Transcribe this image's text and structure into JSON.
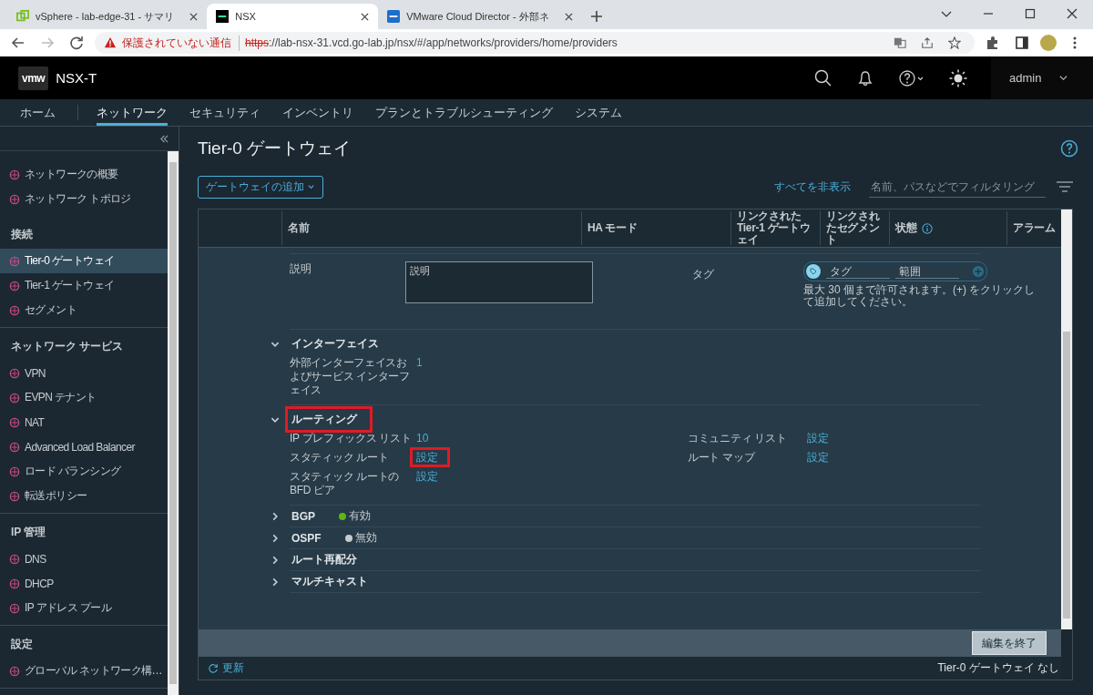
{
  "browser": {
    "tabs": [
      {
        "title": "vSphere - lab-edge-31 - サマリ",
        "selected": false
      },
      {
        "title": "NSX",
        "selected": true
      },
      {
        "title": "VMware Cloud Director - 外部ネ",
        "selected": false
      }
    ],
    "warning": "保護されていない通信",
    "scheme": "https",
    "url": "://lab-nsx-31.vcd.go-lab.jp/nsx/#/app/networks/providers/home/providers"
  },
  "app": {
    "logo": "vmw",
    "product": "NSX-T",
    "user": "admin"
  },
  "nav": [
    {
      "label": "ホーム",
      "selected": false
    },
    {
      "label": "ネットワーク",
      "selected": true
    },
    {
      "label": "セキュリティ",
      "selected": false
    },
    {
      "label": "インベントリ",
      "selected": false
    },
    {
      "label": "プランとトラブルシューティング",
      "selected": false
    },
    {
      "label": "システム",
      "selected": false
    }
  ],
  "sidebar": {
    "sections": [
      {
        "items": [
          {
            "label": "ネットワークの概要",
            "selected": false
          },
          {
            "label": "ネットワーク トポロジ",
            "selected": false
          }
        ]
      },
      {
        "heading": "接続",
        "items": [
          {
            "label": "Tier-0 ゲートウェイ",
            "selected": true
          },
          {
            "label": "Tier-1 ゲートウェイ",
            "selected": false
          },
          {
            "label": "セグメント",
            "selected": false
          }
        ]
      },
      {
        "heading": "ネットワーク サービス",
        "items": [
          {
            "label": "VPN",
            "selected": false
          },
          {
            "label": "EVPN テナント",
            "selected": false
          },
          {
            "label": "NAT",
            "selected": false
          },
          {
            "label": "Advanced Load Balancer",
            "selected": false
          },
          {
            "label": "ロード バランシング",
            "selected": false
          },
          {
            "label": "転送ポリシー",
            "selected": false
          }
        ]
      },
      {
        "heading": "IP 管理",
        "items": [
          {
            "label": "DNS",
            "selected": false
          },
          {
            "label": "DHCP",
            "selected": false
          },
          {
            "label": "IP アドレス プール",
            "selected": false
          }
        ]
      },
      {
        "heading": "設定",
        "items": [
          {
            "label": "グローバル ネットワーク構…",
            "selected": false
          }
        ]
      }
    ]
  },
  "page": {
    "title": "Tier-0 ゲートウェイ",
    "add_button": "ゲートウェイの追加",
    "hide_all": "すべてを非表示",
    "filter_placeholder": "名前、パスなどでフィルタリング"
  },
  "table": {
    "columns": [
      "名前",
      "HA モード",
      "リンクされた Tier-1 ゲートウェイ",
      "リンクされたセグメント",
      "状態",
      "アラーム"
    ]
  },
  "description": {
    "label": "説明",
    "placeholder": "説明"
  },
  "tags": {
    "label": "タグ",
    "tag_placeholder": "タグ",
    "scope_placeholder": "範囲",
    "hint": "最大 30 個まで許可されます。(+) をクリックして追加してください。"
  },
  "sections": [
    {
      "title": "インターフェイス",
      "expanded": true,
      "highlighted": false,
      "fields": [
        {
          "label": "外部インターフェイスおよびサービス インターフェイス",
          "value": "1",
          "highlighted": false
        }
      ]
    },
    {
      "title": "ルーティング",
      "expanded": true,
      "highlighted": true,
      "fields": [
        {
          "label": "IP プレフィックス リスト",
          "value": "10",
          "highlighted": false
        },
        {
          "label": "コミュニティ リスト",
          "value": "設定",
          "highlighted": false
        },
        {
          "label": "スタティック ルート",
          "value": "設定",
          "highlighted": true
        },
        {
          "label": "ルート マップ",
          "value": "設定",
          "highlighted": false
        },
        {
          "label": "スタティック ルートの BFD ピア",
          "value": "設定",
          "highlighted": false
        }
      ]
    },
    {
      "title": "BGP",
      "expanded": false,
      "highlighted": false,
      "status": {
        "text": "有効",
        "color": "#60b515"
      }
    },
    {
      "title": "OSPF",
      "expanded": false,
      "highlighted": false,
      "status": {
        "text": "無効",
        "color": "#c8ccd0"
      }
    },
    {
      "title": "ルート再配分",
      "expanded": false,
      "highlighted": false
    },
    {
      "title": "マルチキャスト",
      "expanded": false,
      "highlighted": false
    }
  ],
  "footer": {
    "done_button": "編集を終了",
    "refresh": "更新",
    "summary": "Tier-0 ゲートウェイ なし"
  }
}
